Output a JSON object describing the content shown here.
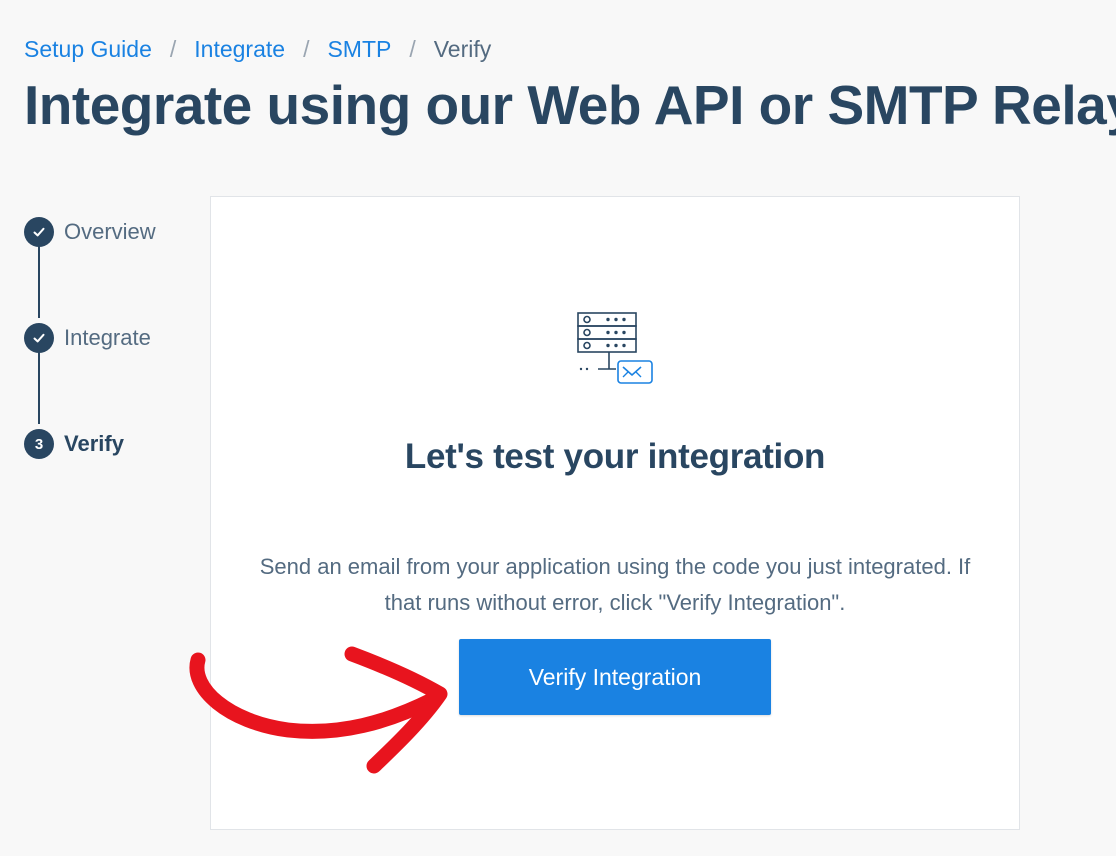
{
  "breadcrumb": {
    "items": [
      "Setup Guide",
      "Integrate",
      "SMTP",
      "Verify"
    ],
    "separator": "/"
  },
  "page_title": "Integrate using our Web API or SMTP Relay",
  "stepper": {
    "steps": [
      {
        "label": "Overview",
        "state": "complete",
        "indicator": "check-icon"
      },
      {
        "label": "Integrate",
        "state": "complete",
        "indicator": "check-icon"
      },
      {
        "label": "Verify",
        "state": "current",
        "number": "3"
      }
    ]
  },
  "card": {
    "illustration_icon": "server-mail-icon",
    "heading": "Let's test your integration",
    "description": "Send an email from your application using the code you just integrated. If that runs without error, click \"Verify Integration\".",
    "button_label": "Verify Integration"
  },
  "annotation": {
    "icon": "red-arrow-icon",
    "color": "#e8141e"
  },
  "colors": {
    "link": "#1a82e2",
    "title": "#294661",
    "text": "#546b81",
    "button": "#1a82e2",
    "background": "#f8f8f8"
  }
}
